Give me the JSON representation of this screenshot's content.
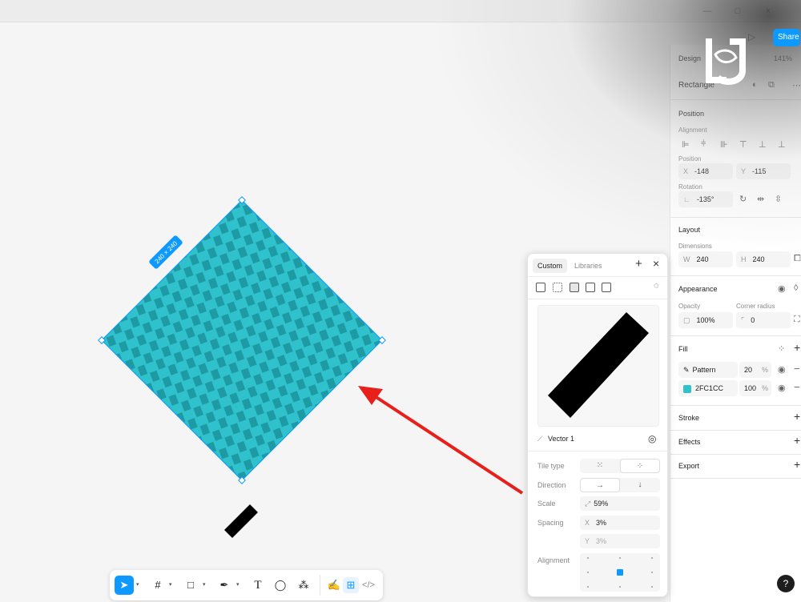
{
  "header": {
    "share_label": "Share",
    "play_icon": "play-icon"
  },
  "right_panel": {
    "tab_design": "Design",
    "zoom": "141%",
    "layer_name": "Rectangle",
    "position_title": "Position",
    "alignment_label": "Alignment",
    "position_label": "Position",
    "x_prefix": "X",
    "x_value": "-148",
    "y_prefix": "Y",
    "y_value": "-115",
    "rotation_label": "Rotation",
    "rotation_value": "-135°",
    "layout_title": "Layout",
    "dimensions_label": "Dimensions",
    "w_prefix": "W",
    "w_value": "240",
    "h_prefix": "H",
    "h_value": "240",
    "appearance_title": "Appearance",
    "opacity_label": "Opacity",
    "opacity_value": "100%",
    "corner_radius_label": "Corner radius",
    "corner_radius_value": "0",
    "fill_title": "Fill",
    "fills": [
      {
        "name": "Pattern",
        "opacity": "20",
        "unit": "%",
        "swatch": "#000000"
      },
      {
        "name": "2FC1CC",
        "opacity": "100",
        "unit": "%",
        "swatch": "#2FC1CC"
      }
    ],
    "stroke_title": "Stroke",
    "effects_title": "Effects",
    "export_title": "Export"
  },
  "pattern_popover": {
    "tab_custom": "Custom",
    "tab_libraries": "Libraries",
    "source_name": "Vector 1",
    "tile_type_label": "Tile type",
    "direction_label": "Direction",
    "scale_label": "Scale",
    "scale_value": "59%",
    "spacing_label": "Spacing",
    "spacing_x_prefix": "X",
    "spacing_x_value": "3%",
    "spacing_y_prefix": "Y",
    "spacing_y_value": "3%",
    "alignment_label": "Alignment"
  },
  "canvas": {
    "dimension_badge": "240 × 240",
    "fill_color": "#2FC1CC",
    "stripe_color": "#1E9AA4",
    "selection_color": "#0D99FF",
    "arrow_color": "#E8201B"
  },
  "toolbar": {
    "tools": [
      "move-tool",
      "frame-tool",
      "shape-tool",
      "pen-tool",
      "text-tool",
      "comment-tool",
      "actions-tool"
    ],
    "modes": [
      "draw-mode",
      "design-mode",
      "dev-mode"
    ]
  },
  "help_label": "?"
}
